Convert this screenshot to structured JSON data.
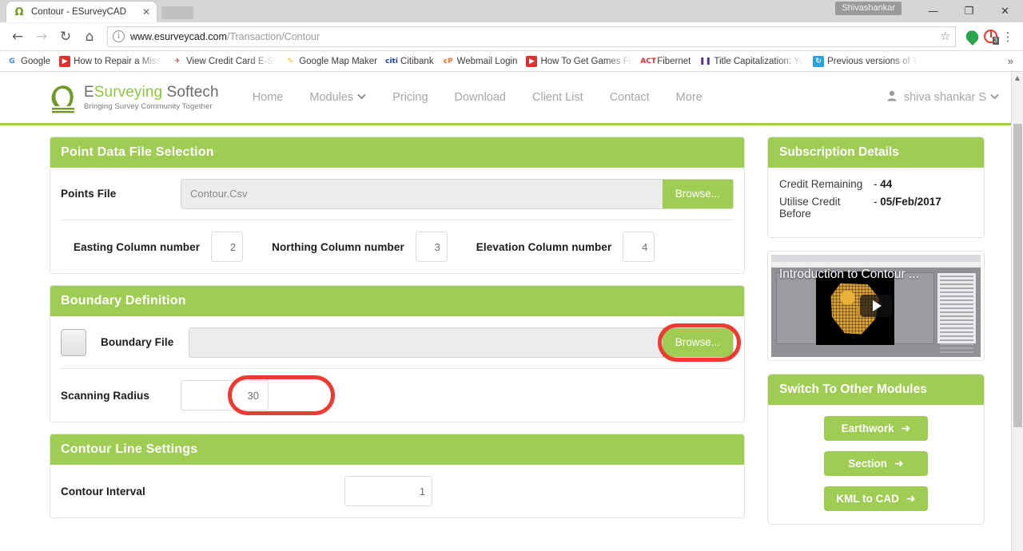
{
  "browser": {
    "tab": {
      "title": "Contour - ESurveyCAD",
      "favicon": "omega-logo-icon",
      "close": "✕"
    },
    "profile_chip": "Shivashankar",
    "window_controls": {
      "minimize": "—",
      "maximize": "❐",
      "close": "✕"
    },
    "nav": {
      "back": "←",
      "forward": "→",
      "reload": "↻",
      "home": "⌂"
    },
    "omnibox": {
      "info": "i",
      "host": "www.esurveycad.com",
      "path": "/Transaction/Contour",
      "star": "☆"
    },
    "extensions": {
      "badge_count": "3"
    },
    "menu": "⋮",
    "bookmarks": [
      {
        "label": "Google",
        "icon": "G",
        "color": "#ffffff",
        "text_color": "#4285f4"
      },
      {
        "label": "How to Repair a Missi",
        "icon": "▶",
        "color": "#e02f2f",
        "text_color": "#ffffff",
        "truncated": true
      },
      {
        "label": "View Credit Card E-St",
        "icon": "✈",
        "color": "#ffffff",
        "text_color": "#e53935",
        "truncated": true
      },
      {
        "label": "Google Map Maker",
        "icon": "✎",
        "color": "#ffffff",
        "text_color": "#f4b400"
      },
      {
        "label": "Citibank",
        "icon": "citi",
        "color": "#ffffff",
        "text_color": "#1c3f94"
      },
      {
        "label": "Webmail Login",
        "icon": "cP",
        "color": "#ffffff",
        "text_color": "#ff6c2c"
      },
      {
        "label": "How To Get Games Fo",
        "icon": "▶",
        "color": "#e02f2f",
        "text_color": "#ffffff",
        "truncated": true
      },
      {
        "label": "Fibernet",
        "icon": "ACT",
        "color": "#ffffff",
        "text_color": "#e02f2f"
      },
      {
        "label": "Title Capitalization: Yo",
        "icon": "❚❚",
        "color": "#ffffff",
        "text_color": "#5b2d8e",
        "truncated": true
      },
      {
        "label": "Previous versions of T",
        "icon": "↻",
        "color": "#29a3dc",
        "text_color": "#ffffff",
        "truncated": true
      }
    ],
    "bookmarks_overflow": "»"
  },
  "site": {
    "logo": {
      "mark": "omega-arch-icon",
      "name_part1": "E",
      "name_part2": "Surveying",
      "name_part3": " Softech",
      "tagline": "Bringing Survey Community Together"
    },
    "nav": [
      {
        "label": "Home",
        "caret": false
      },
      {
        "label": "Modules",
        "caret": true
      },
      {
        "label": "Pricing",
        "caret": false
      },
      {
        "label": "Download",
        "caret": false
      },
      {
        "label": "Client List",
        "caret": false
      },
      {
        "label": "Contact",
        "caret": false
      },
      {
        "label": "More",
        "caret": false
      }
    ],
    "caret_glyph": "⌄",
    "account": {
      "icon": "👤",
      "name": "shiva shankar S",
      "caret": "⌄"
    },
    "accent_color": "#9fcc52"
  },
  "main": {
    "panels": [
      {
        "title": "Point Data File Selection",
        "rows": {
          "points_file": {
            "label": "Points File",
            "value": "Contour.Csv",
            "browse_label": "Browse..."
          },
          "columns": [
            {
              "label": "Easting Column number",
              "value": "2"
            },
            {
              "label": "Northing Column number",
              "value": "3"
            },
            {
              "label": "Elevation Column number",
              "value": "4"
            }
          ]
        }
      },
      {
        "title": "Boundary Definition",
        "rows": {
          "boundary_file": {
            "checkbox_checked": false,
            "label": "Boundary File",
            "value": "",
            "browse_label": "Browse...",
            "highlighted": true
          },
          "scanning_radius": {
            "label": "Scanning Radius",
            "value": "30",
            "highlighted": true
          }
        }
      },
      {
        "title": "Contour Line Settings",
        "rows": {
          "contour_interval": {
            "label": "Contour Interval",
            "value": "1"
          }
        }
      }
    ]
  },
  "sidebar": {
    "subscription": {
      "title": "Subscription Details",
      "lines": [
        {
          "key": "Credit Remaining",
          "dash": "-",
          "value": "44"
        },
        {
          "key": "Utilise Credit Before",
          "dash": "-",
          "value": "05/Feb/2017"
        }
      ]
    },
    "video": {
      "title": "Introduction to Contour ...",
      "play_icon": "play-button-icon"
    },
    "modules": {
      "title": "Switch To Other Modules",
      "buttons": [
        {
          "label": "Earthwork",
          "arrow": "➜"
        },
        {
          "label": "Section",
          "arrow": "➜"
        },
        {
          "label": "KML to CAD",
          "arrow": "➜"
        }
      ]
    }
  },
  "annotation": {
    "ring_color": "#ef3a34"
  },
  "scrollbar": {
    "up_arrow": "▲",
    "down_arrow": "▼"
  }
}
